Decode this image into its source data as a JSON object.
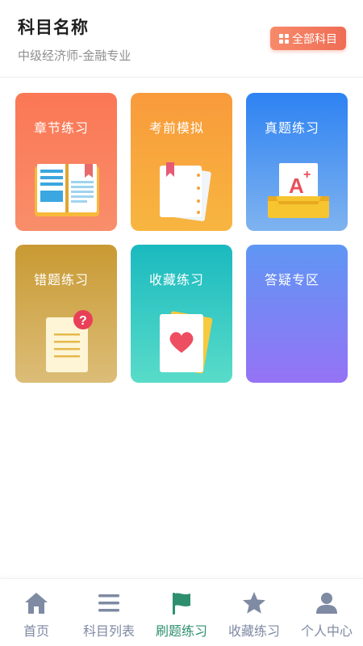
{
  "header": {
    "title": "科目名称",
    "subtitle": "中级经济师-金融专业",
    "all_subjects_label": "全部科目"
  },
  "cards": [
    {
      "label": "章节练习",
      "icon": "open-book-icon"
    },
    {
      "label": "考前模拟",
      "icon": "notebook-icon"
    },
    {
      "label": "真题练习",
      "icon": "grade-tray-icon"
    },
    {
      "label": "错题练习",
      "icon": "question-note-icon"
    },
    {
      "label": "收藏练习",
      "icon": "heart-card-icon"
    },
    {
      "label": "答疑专区",
      "icon": ""
    }
  ],
  "tabbar": {
    "items": [
      {
        "label": "首页",
        "icon": "home-icon",
        "active": false
      },
      {
        "label": "科目列表",
        "icon": "list-icon",
        "active": false
      },
      {
        "label": "刷题练习",
        "icon": "flag-icon",
        "active": true
      },
      {
        "label": "收藏练习",
        "icon": "star-icon",
        "active": false
      },
      {
        "label": "个人中心",
        "icon": "person-icon",
        "active": false
      }
    ]
  },
  "colors": {
    "accent_orange": "#ef6d55",
    "tab_active": "#2e8f6f",
    "tab_inactive": "#7f8aa3"
  }
}
